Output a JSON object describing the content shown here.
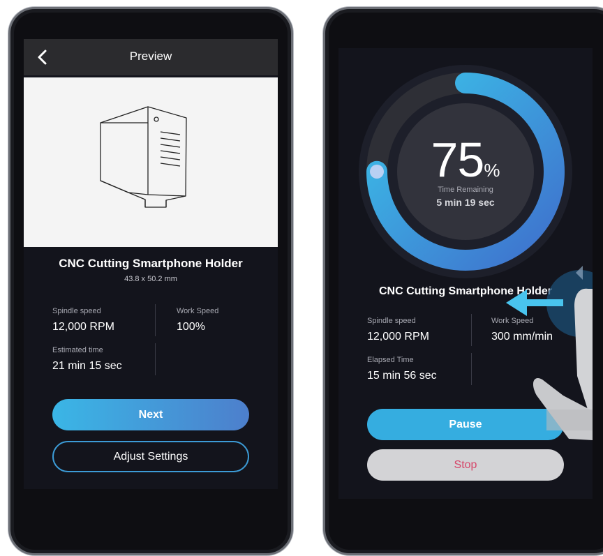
{
  "preview_screen": {
    "header": {
      "title": "Preview",
      "back_icon": "chevron-left-icon"
    },
    "project": {
      "title": "CNC Cutting Smartphone Holder",
      "dimensions": "43.8 x 50.2 mm"
    },
    "stats": {
      "spindle_label": "Spindle speed",
      "spindle_value": "12,000 RPM",
      "work_label": "Work Speed",
      "work_value": "100%",
      "time_label": "Estimated time",
      "time_value": "21 min 15 sec"
    },
    "buttons": {
      "next": "Next",
      "adjust": "Adjust Settings"
    }
  },
  "progress_screen": {
    "progress": {
      "percent": 75,
      "percent_text": "75",
      "unit": "%",
      "remaining_label": "Time Remaining",
      "remaining_value": "5 min 19 sec"
    },
    "project": {
      "title": "CNC Cutting Smartphone Holder"
    },
    "stats": {
      "spindle_label": "Spindle speed",
      "spindle_value": "12,000 RPM",
      "work_label": "Work Speed",
      "work_value": "300 mm/min",
      "time_label": "Elapsed Time",
      "time_value": "15 min 56 sec"
    },
    "buttons": {
      "pause": "Pause",
      "stop": "Stop"
    },
    "gesture": {
      "icons": [
        "swipe-left-arrow-icon",
        "hand-pointer-icon"
      ]
    }
  },
  "colors": {
    "accent": "#3ab6e6",
    "accent_dark": "#4d7fcc",
    "stop_text": "#d6476a",
    "screen_bg": "#13141c"
  }
}
